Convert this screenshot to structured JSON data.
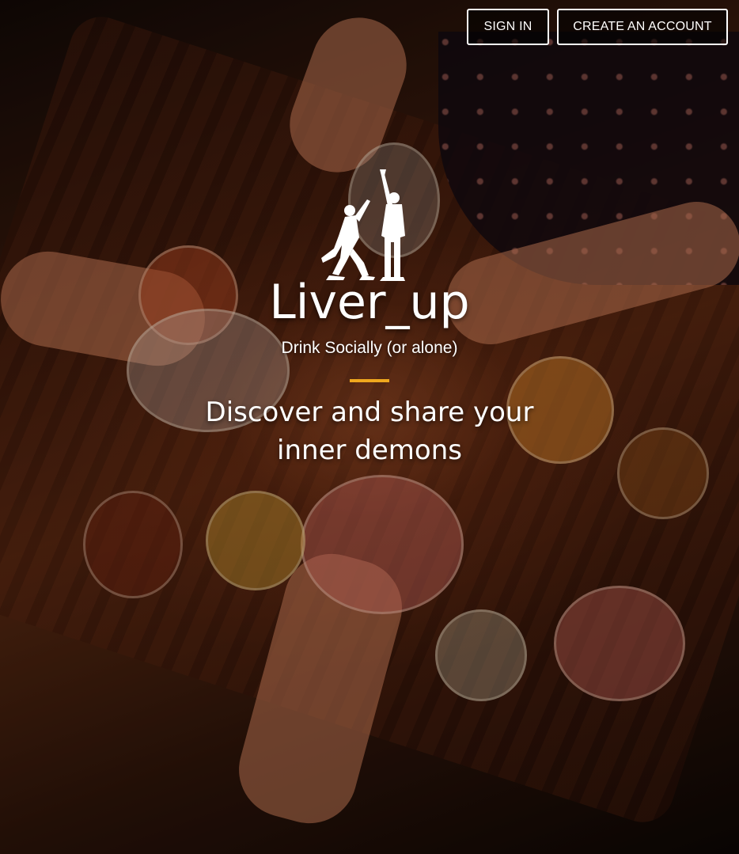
{
  "nav": {
    "sign_in_label": "SIGN IN",
    "create_account_label": "CREATE AN ACCOUNT"
  },
  "hero": {
    "logo_icon": "toasting-men-logo-icon",
    "brand_name": "Liver_up",
    "tagline": "Drink Socially (or alone)",
    "headline": "Discover and share your inner demons"
  },
  "colors": {
    "accent": "#f0a81e",
    "text": "#ffffff"
  }
}
